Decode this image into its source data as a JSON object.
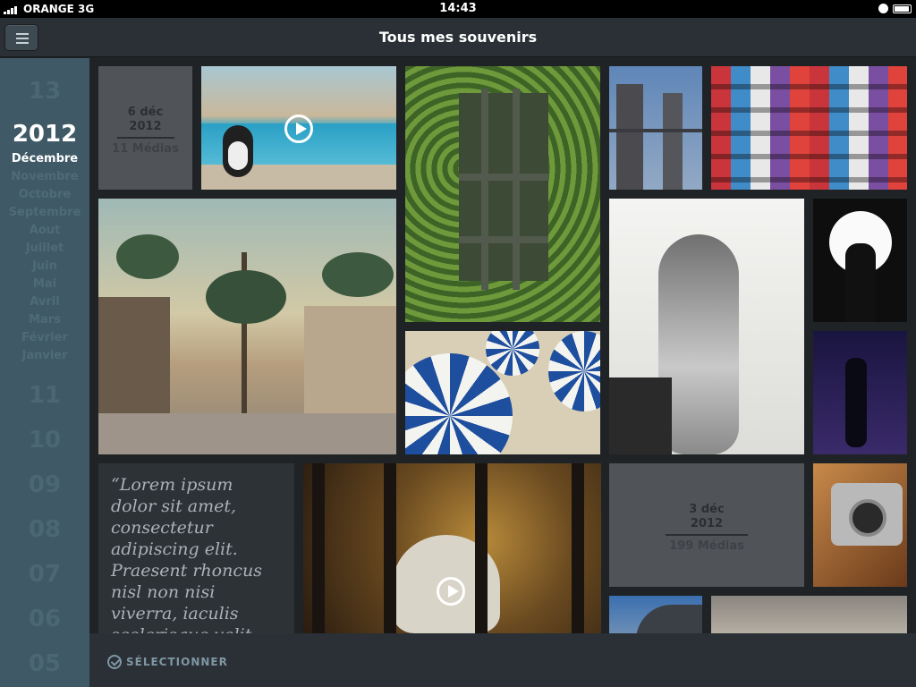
{
  "status_bar": {
    "carrier": "ORANGE 3G",
    "time": "14:43"
  },
  "nav": {
    "title": "Tous mes souvenirs",
    "menu_icon": "hamburger-menu-icon"
  },
  "timeline": {
    "year": "2012",
    "active_month": "Décembre",
    "months": [
      "Novembre",
      "Octobre",
      "Septembre",
      "Aout",
      "Juillet",
      "Juin",
      "Mai",
      "Avril",
      "Mars",
      "Février",
      "Janvier"
    ],
    "prev_year_number": "13",
    "day_numbers": [
      "11",
      "10",
      "09",
      "08",
      "07",
      "06",
      "05"
    ]
  },
  "groups": [
    {
      "day": "6 déc",
      "year": "2012",
      "count": "11 Médias"
    },
    {
      "day": "3 déc",
      "year": "2012",
      "count": "199 Médias"
    }
  ],
  "quote": "“Lorem ipsum dolor sit amet, consectetur adipiscing elit. Praesent rhoncus nisl non nisi viverra, iaculis scelerisque velit",
  "bottom_bar": {
    "select_label": "SÉLECTIONNER"
  },
  "colors": {
    "accent": "#4a6773",
    "sidebar": "#3f5a66",
    "bar": "#2a3035"
  }
}
